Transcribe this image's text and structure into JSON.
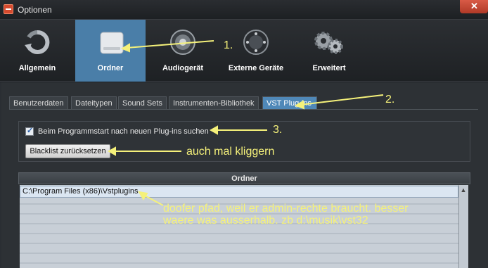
{
  "window": {
    "title": "Optionen"
  },
  "toolbar": {
    "items": [
      {
        "label": "Allgemein",
        "icon": "refresh-icon",
        "active": false
      },
      {
        "label": "Ordner",
        "icon": "drive-icon",
        "active": true
      },
      {
        "label": "Audiogerät",
        "icon": "speaker-icon",
        "active": false
      },
      {
        "label": "Externe Geräte",
        "icon": "knob-icon",
        "active": false
      },
      {
        "label": "Erweitert",
        "icon": "gears-icon",
        "active": false
      }
    ]
  },
  "tabs": [
    {
      "label": "Benutzerdaten",
      "active": false
    },
    {
      "label": "Dateitypen",
      "active": false
    },
    {
      "label": "Sound Sets",
      "active": false
    },
    {
      "label": "Instrumenten-Bibliothek",
      "active": false
    },
    {
      "label": "VST Plug-ins",
      "active": true
    }
  ],
  "settings": {
    "scan_checkbox_label": "Beim Programmstart nach neuen Plug-ins suchen",
    "scan_checkbox_checked": true,
    "blacklist_button": "Blacklist zurücksetzen"
  },
  "folder_list": {
    "header": "Ordner",
    "rows": [
      "C:\\Program Files (x86)\\Vstplugins"
    ]
  },
  "annotations": {
    "step1": "1.",
    "step2": "2.",
    "step3": "3.",
    "click_note": "auch mal kliggern",
    "path_note_line1": "doofer pfad, weil er admin-rechte braucht. besser",
    "path_note_line2": "waere was ausserhalb. zb d:\\musik\\vst32"
  },
  "colors": {
    "accent": "#4a7ea8",
    "annotation": "#f5f17a",
    "close": "#c84a35"
  }
}
